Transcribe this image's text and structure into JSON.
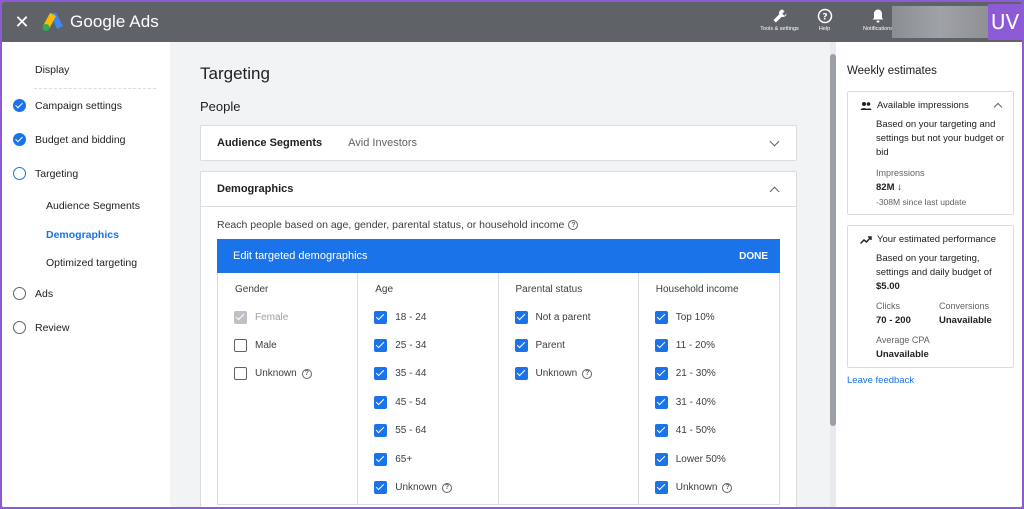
{
  "app": {
    "brand": "Google Ads",
    "colors": {
      "accent": "#1a73e8",
      "topbar": "#5f6368",
      "frame": "#8e5bd6"
    }
  },
  "header": {
    "close_icon": "close-icon",
    "actions": [
      {
        "icon": "wrench-icon",
        "label": "Tools & settings"
      },
      {
        "icon": "help-icon",
        "label": "Help"
      },
      {
        "icon": "bell-icon",
        "label": "Notifications"
      }
    ],
    "badge": "UV"
  },
  "sidebar": {
    "items": [
      {
        "label": "Display",
        "state": "none"
      },
      {
        "label": "Campaign settings",
        "state": "done"
      },
      {
        "label": "Budget and bidding",
        "state": "done"
      },
      {
        "label": "Targeting",
        "state": "current"
      },
      {
        "label": "Audience Segments",
        "state": "sub"
      },
      {
        "label": "Demographics",
        "state": "sub-active"
      },
      {
        "label": "Optimized targeting",
        "state": "sub"
      },
      {
        "label": "Ads",
        "state": "todo"
      },
      {
        "label": "Review",
        "state": "todo"
      }
    ]
  },
  "main": {
    "title": "Targeting",
    "section": "People",
    "audience_card": {
      "label": "Audience Segments",
      "value": "Avid Investors"
    },
    "demographics": {
      "label": "Demographics",
      "description": "Reach people based on age, gender, parental status, or household income",
      "edit_bar": "Edit targeted demographics",
      "done": "DONE",
      "columns": [
        {
          "header": "Gender",
          "options": [
            {
              "label": "Female",
              "state": "disabled"
            },
            {
              "label": "Male",
              "state": "off"
            },
            {
              "label": "Unknown",
              "state": "off",
              "help": true
            }
          ]
        },
        {
          "header": "Age",
          "options": [
            {
              "label": "18 - 24",
              "state": "on"
            },
            {
              "label": "25 - 34",
              "state": "on"
            },
            {
              "label": "35 - 44",
              "state": "on"
            },
            {
              "label": "45 - 54",
              "state": "on"
            },
            {
              "label": "55 - 64",
              "state": "on"
            },
            {
              "label": "65+",
              "state": "on"
            },
            {
              "label": "Unknown",
              "state": "on",
              "help": true
            }
          ]
        },
        {
          "header": "Parental status",
          "options": [
            {
              "label": "Not a parent",
              "state": "on"
            },
            {
              "label": "Parent",
              "state": "on"
            },
            {
              "label": "Unknown",
              "state": "on",
              "help": true
            }
          ]
        },
        {
          "header": "Household income",
          "options": [
            {
              "label": "Top 10%",
              "state": "on"
            },
            {
              "label": "11 - 20%",
              "state": "on"
            },
            {
              "label": "21 - 30%",
              "state": "on"
            },
            {
              "label": "31 - 40%",
              "state": "on"
            },
            {
              "label": "41 - 50%",
              "state": "on"
            },
            {
              "label": "Lower 50%",
              "state": "on"
            },
            {
              "label": "Unknown",
              "state": "on",
              "help": true
            }
          ]
        }
      ]
    }
  },
  "estimates": {
    "title": "Weekly estimates",
    "impressions": {
      "label": "Available impressions",
      "text": "Based on your targeting and settings but not your budget or bid",
      "metric_label": "Impressions",
      "metric_value": "82M ↓",
      "delta": "-308M since last update"
    },
    "performance": {
      "label": "Your estimated performance",
      "text": "Based on your targeting, settings and daily budget of",
      "budget": "$5.00",
      "clicks_label": "Clicks",
      "clicks_value": "70 - 200",
      "conversions_label": "Conversions",
      "conversions_value": "Unavailable",
      "cpa_label": "Average CPA",
      "cpa_value": "Unavailable"
    },
    "feedback": "Leave feedback"
  }
}
